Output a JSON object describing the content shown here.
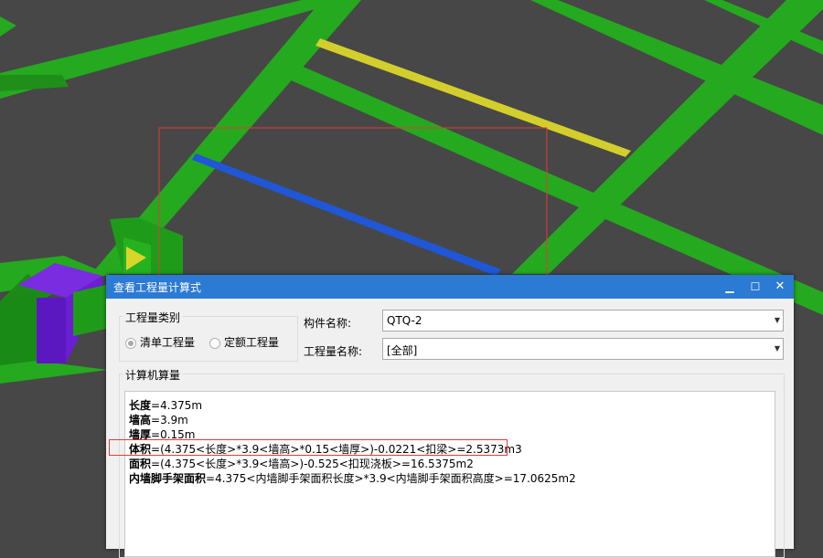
{
  "dialog": {
    "title": "查看工程量计算式",
    "controls": {
      "minimize": "▁",
      "maximize": "☐",
      "close": "✕"
    },
    "category_group": {
      "title": "工程量类别",
      "options": [
        {
          "label": "清单工程量",
          "checked": true
        },
        {
          "label": "定额工程量",
          "checked": false
        }
      ]
    },
    "component_label": "构件名称:",
    "component_value": "QTQ-2",
    "quantity_label": "工程量名称:",
    "quantity_value": "[全部]",
    "calc_group_title": "计算机算量",
    "lines": [
      {
        "name": "长度",
        "rest": "=4.375m"
      },
      {
        "name": "墙高",
        "rest": "=3.9m"
      },
      {
        "name": "墙厚",
        "rest": "=0.15m"
      },
      {
        "name": "体积",
        "rest": "=(4.375<长度>*3.9<墙高>*0.15<墙厚>)-0.0221<扣梁>=2.5373m3"
      },
      {
        "name": "面积",
        "rest": "=(4.375<长度>*3.9<墙高>)-0.525<扣现浇板>=16.5375m2"
      },
      {
        "name": "内墙脚手架面积",
        "rest": "=4.375<内墙脚手架面积长度>*3.9<内墙脚手架面积高度>=17.0625m2"
      }
    ]
  },
  "colors": {
    "background": "#474747",
    "green_beam": "#25a91f",
    "yellow_beam": "#d2cf2c",
    "blue_beam": "#1f57d6",
    "purple_block": "#6a1fd1",
    "title_bar": "#2b7ad3",
    "highlight": "#e53935"
  }
}
